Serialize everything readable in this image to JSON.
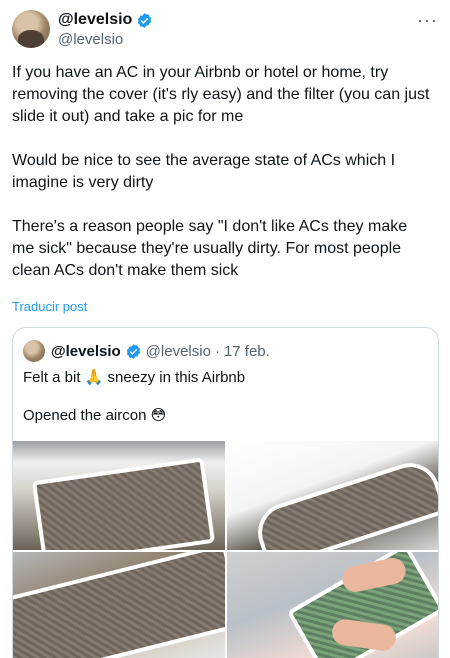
{
  "tweet": {
    "display_name": "@levelsio",
    "handle": "@levelsio",
    "more_label": "···",
    "text": "If you have an AC in your Airbnb or hotel or home, try removing the cover (it's rly easy) and the filter (you can just slide it out) and take a pic for me\n\nWould be nice to see the average state of ACs which I imagine is very dirty\n\nThere's a reason people say \"I don't like ACs they make me sick\" because they're usually dirty. For most people clean ACs don't make them sick",
    "translate_label": "Traducir post"
  },
  "quote": {
    "display_name": "@levelsio",
    "handle": "@levelsio",
    "separator": "·",
    "date": "17 feb.",
    "text": "Felt a bit 🙏 sneezy in this Airbnb\n\nOpened the aircon 😳"
  },
  "colors": {
    "accent": "#1d9bf0",
    "secondary_text": "#536471",
    "border": "#cfd9de"
  },
  "icons": {
    "verified": "verified-badge-icon",
    "more": "more-horizontal-icon"
  }
}
